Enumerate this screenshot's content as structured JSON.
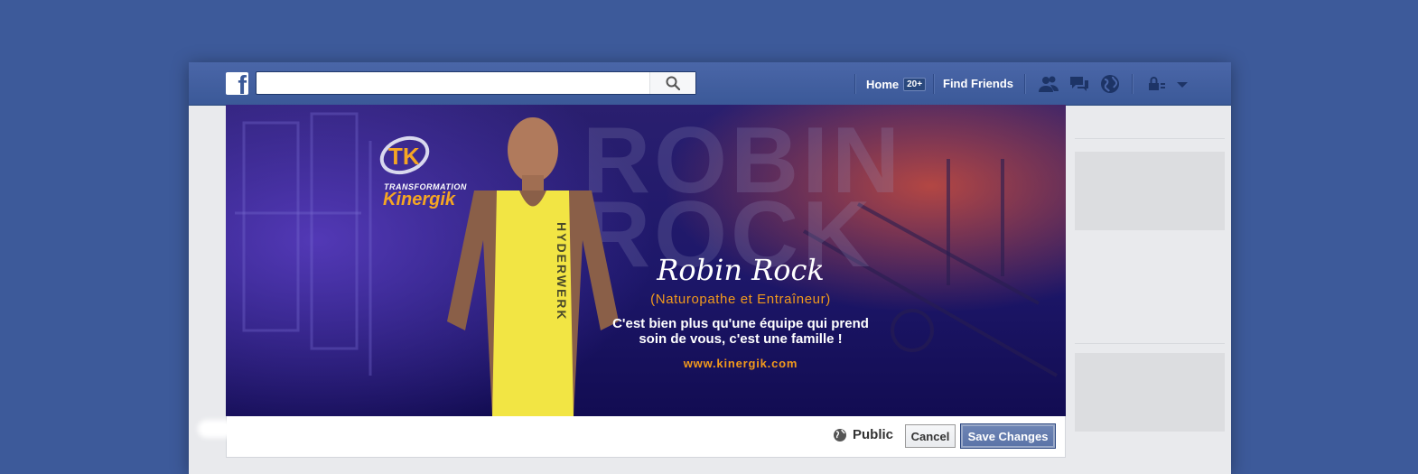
{
  "topbar": {
    "logo_letter": "f",
    "search": {
      "placeholder": "",
      "value": ""
    },
    "nav": {
      "home_label": "Home",
      "home_badge": "20+",
      "find_friends_label": "Find Friends"
    },
    "icons": [
      "friend-requests-icon",
      "messages-icon",
      "notifications-globe-icon",
      "privacy-lock-icon",
      "account-menu-chevron-icon"
    ]
  },
  "cover": {
    "brand_sub": "TRANSFORMATION",
    "brand_name": "Kinergik",
    "logo_letters": "TK",
    "watermark_line1": "ROBIN",
    "watermark_line2": "ROCK",
    "shirt_text": "HYDERWERK",
    "name": "Robin Rock",
    "subtitle": "(Naturopathe et Entraîneur)",
    "tagline_line1": "C'est bien plus qu'une équipe qui prend",
    "tagline_line2": "soin de vous, c'est une famille !",
    "website": "www.kinergik.com"
  },
  "editbar": {
    "privacy_label": "Public",
    "cancel_label": "Cancel",
    "save_label": "Save Changes"
  },
  "colors": {
    "background": "#3d5a9a",
    "topbar": "#3b5998",
    "accent_orange": "#f29a1c",
    "save_button": "#5b74a8"
  }
}
